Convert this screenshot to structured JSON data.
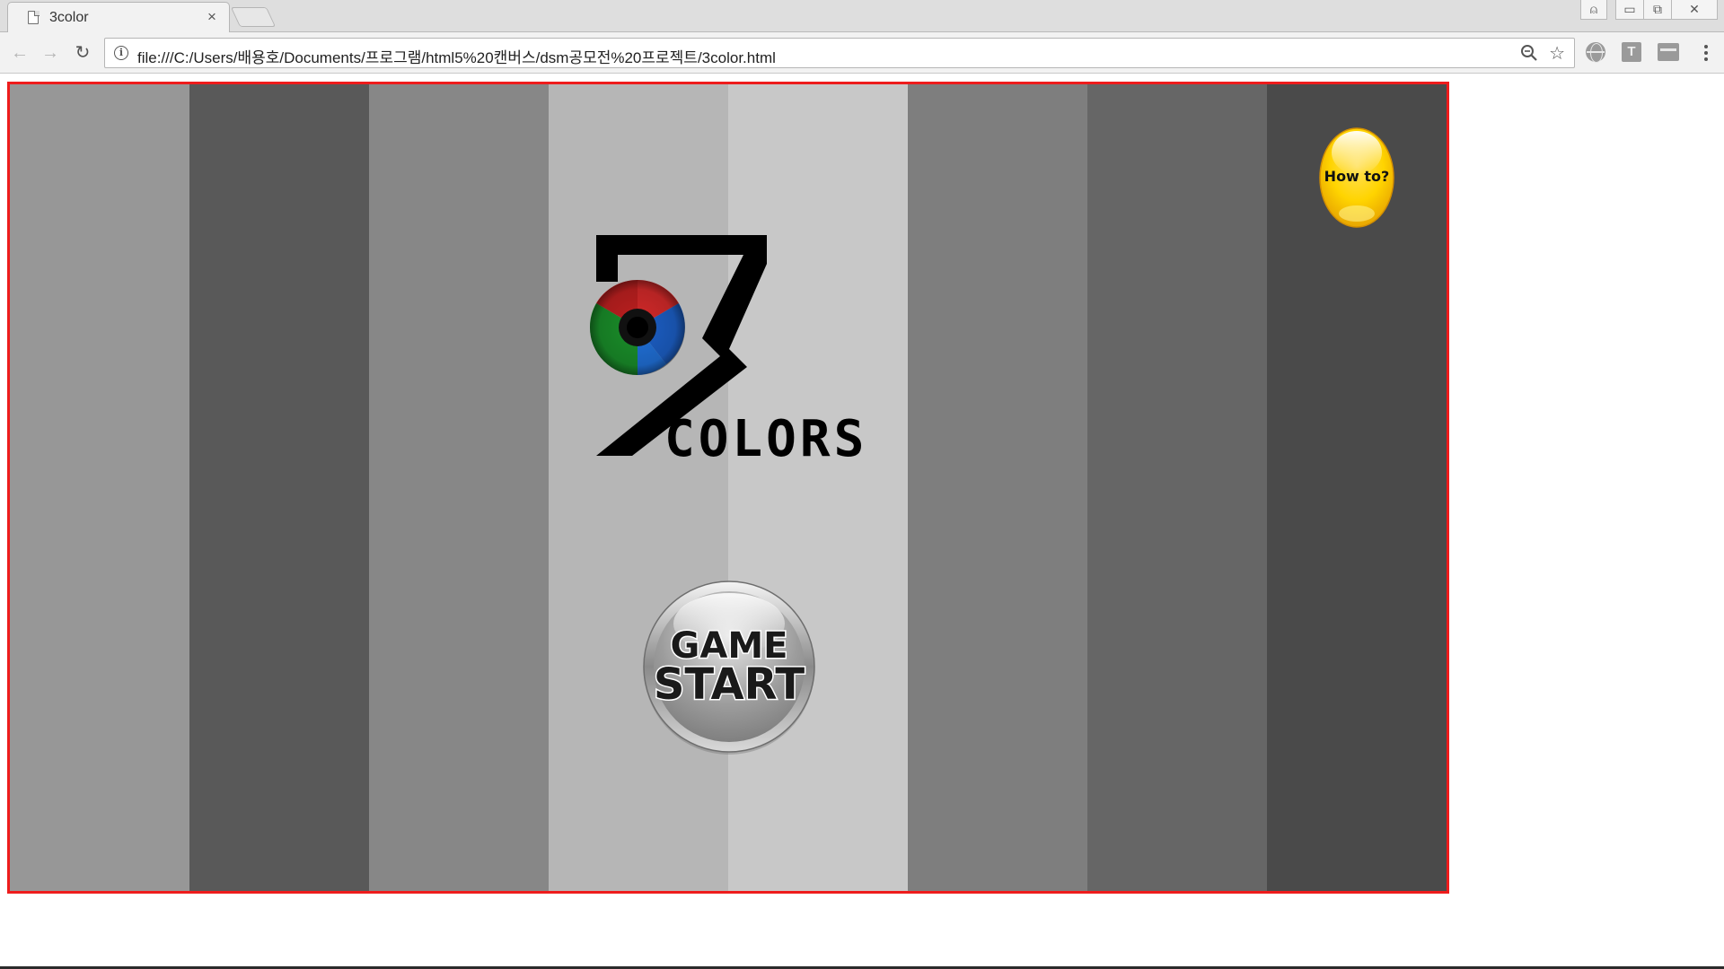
{
  "browser": {
    "tab": {
      "title": "3color",
      "close_glyph": "×"
    },
    "nav": {
      "back_glyph": "←",
      "forward_glyph": "→",
      "reload_glyph": "↻"
    },
    "address": {
      "url": "file:///C:/Users/배용호/Documents/프로그램/html5%20캔버스/dsm공모전%20프로젝트/3color.html"
    },
    "extensions": {
      "translate_label": "T"
    },
    "window": {
      "user_glyph": "⍝",
      "min_glyph": "▭",
      "max_glyph": "⧉",
      "close_glyph": "✕"
    },
    "icons": [
      "page-icon",
      "info-icon",
      "zoom-icon",
      "star-icon",
      "globe-icon",
      "translate-icon",
      "panel-icon",
      "menu-icon"
    ]
  },
  "game": {
    "border_color": "#ee1c1c",
    "stripe_colors": [
      "#979797",
      "#595959",
      "#878787",
      "#b6b6b6",
      "#c8c8c8",
      "#7e7e7e",
      "#666666",
      "#4a4a4a"
    ],
    "logo": {
      "numeral": "3",
      "word": "COLORS",
      "eye_colors": [
        "#d62a2a",
        "#1a8f2a",
        "#1c5fc6"
      ]
    },
    "how_to_button": {
      "label": "How to?",
      "color": "#ffd400"
    },
    "start_button": {
      "line1": "GAME",
      "line2": "START"
    }
  }
}
